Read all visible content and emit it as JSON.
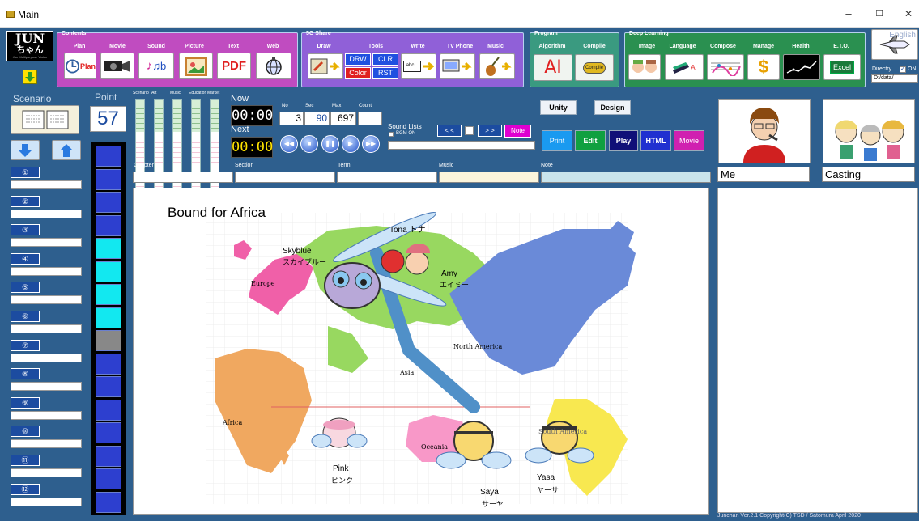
{
  "window": {
    "title": "Main",
    "minimize": "–",
    "maximize": "☐",
    "close": "✕"
  },
  "logo": {
    "line1": "JUN",
    "line2": "ちゃん",
    "tagline": "Jun Multipurpose Vision"
  },
  "contents": {
    "title": "Contents",
    "labels": [
      "Plan",
      "Movie",
      "Sound",
      "Picture",
      "Text",
      "Web"
    ],
    "plan_icon": "Plan",
    "text_icon": "PDF"
  },
  "share": {
    "title": "5G Share",
    "labels": [
      "Draw",
      "Tools",
      "Write",
      "TV Phone",
      "Music"
    ],
    "tools": [
      "DRW",
      "CLR",
      "Color",
      "RST"
    ],
    "write_icon": "abc..."
  },
  "program": {
    "title": "Program",
    "labels": [
      "Algorithm",
      "Compile"
    ],
    "ai": "AI",
    "compile_icon": "Compile"
  },
  "deep": {
    "title": "Deep Learning",
    "labels": [
      "Image",
      "Language",
      "Compose",
      "Manage",
      "Health",
      "E.T.O."
    ],
    "lang_icon": "AI",
    "eto_icon": "Excel"
  },
  "english": {
    "label": "English"
  },
  "directory": {
    "label": "Directry",
    "on": "ON",
    "value": "D:/data/"
  },
  "scenario": {
    "title": "Scenario",
    "items": [
      "①",
      "②",
      "③",
      "④",
      "⑤",
      "⑥",
      "⑦",
      "⑧",
      "⑨",
      "⑩",
      "⑪",
      "⑫"
    ]
  },
  "point": {
    "label": "Point",
    "value": "57",
    "cells": [
      "blue",
      "blue",
      "blue",
      "blue",
      "cyan",
      "cyan",
      "cyan",
      "cyan",
      "gray",
      "blue",
      "blue",
      "blue",
      "blue",
      "blue",
      "blue",
      "blue"
    ]
  },
  "meters": {
    "labels": [
      "Scenario",
      "Art",
      "Music",
      "Education",
      "Market"
    ]
  },
  "timer": {
    "now_label": "Now",
    "now": "00:00",
    "next_label": "Next",
    "next": "00:00"
  },
  "counters": {
    "no_label": "No",
    "sec_label": "Sec",
    "max_label": "Max",
    "count_label": "Count",
    "no": "3",
    "sec": "90",
    "max": "697",
    "count": ""
  },
  "sound": {
    "label": "Sound Lists",
    "bgm": "BGM ON",
    "prev": "< <",
    "next": "> >",
    "note": "Note"
  },
  "actions": {
    "unity": "Unity",
    "design": "Design",
    "print": "Print",
    "edit": "Edit",
    "play": "Play",
    "html": "HTML",
    "movie": "Movie"
  },
  "fields": {
    "chapter": "Chapter",
    "section": "Section",
    "term": "Term",
    "music": "Music",
    "note": "Note"
  },
  "side": {
    "me": "Me",
    "casting": "Casting"
  },
  "map": {
    "title": "Bound for Africa",
    "europe": "Europe",
    "north_america": "North America",
    "asia": "Asia",
    "africa": "Africa",
    "oceania": "Oceania",
    "south_america": "South America",
    "skyblue": "Skyblue",
    "skyblue_jp": "スカイブルー",
    "tona": "Tona トナ",
    "amy": "Amy",
    "amy_jp": "エイミー",
    "pink": "Pink",
    "pink_jp": "ピンク",
    "saya": "Saya",
    "saya_jp": "サーヤ",
    "yasa": "Yasa",
    "yasa_jp": "ヤーサ"
  },
  "footer": "Junchan Ver.2.1 Copyright(C) TSD / Satomura April 2020"
}
